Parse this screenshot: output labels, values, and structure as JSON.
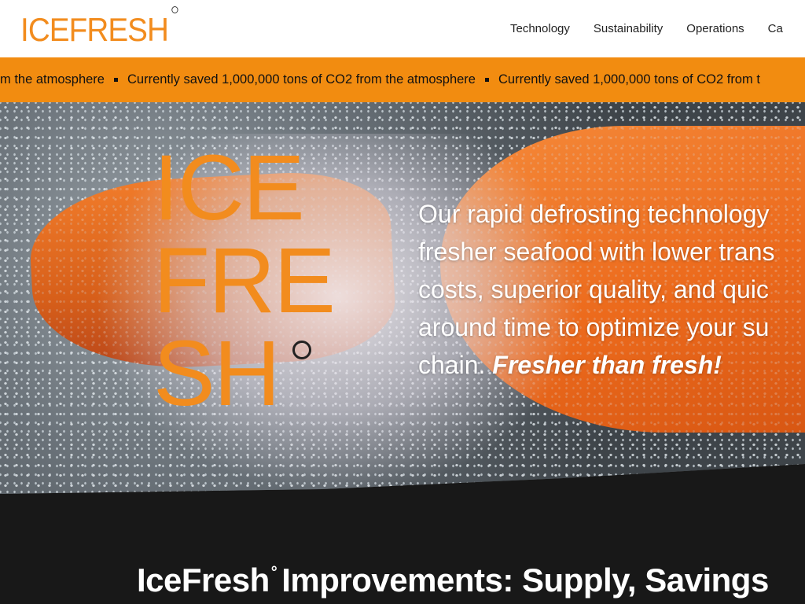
{
  "header": {
    "logo": "ICEFRESH",
    "nav": [
      "Technology",
      "Sustainability",
      "Operations",
      "Ca"
    ]
  },
  "ticker": {
    "lead": "m the atmosphere",
    "item": "Currently saved 1,000,000 tons of CO2 from the atmosphere",
    "tail": "Currently saved 1,000,000 tons of CO2 from t"
  },
  "hero": {
    "big_logo": [
      "ICE",
      "FRE",
      "SH"
    ],
    "lines": [
      "Our rapid defrosting technology",
      "fresher seafood with lower trans",
      "costs, superior quality, and quic",
      "around time to optimize your su"
    ],
    "last_line": "chain.",
    "tagline": "Fresher than fresh!"
  },
  "section": {
    "brand": "IceFresh",
    "degree": "°",
    "bold": "Improvements:",
    "rest": "Supply, Savings"
  },
  "colors": {
    "accent": "#f28c10",
    "dark": "#181818"
  }
}
